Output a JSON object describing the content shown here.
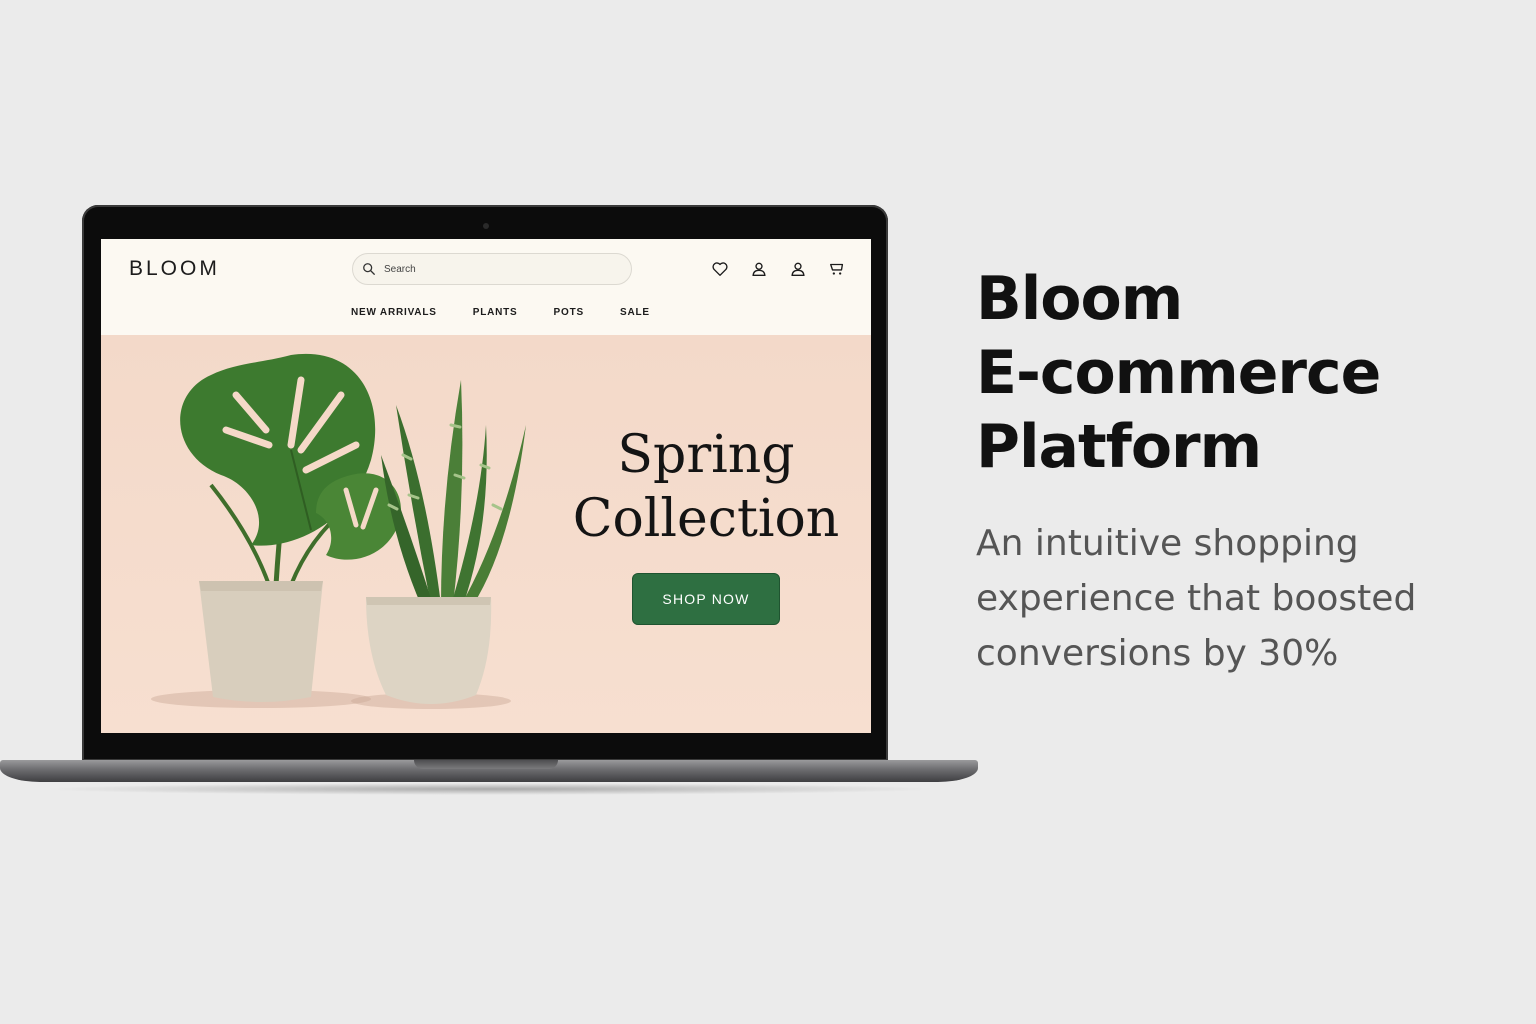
{
  "site": {
    "logo": "BLOOM",
    "search_placeholder": "Search",
    "header_icons": [
      "heart-icon",
      "user-icon",
      "account-icon",
      "cart-icon"
    ],
    "nav": [
      "NEW ARRIVALS",
      "PLANTS",
      "POTS",
      "SALE"
    ]
  },
  "hero": {
    "title_line1": "Spring",
    "title_line2": "Collection",
    "button_label": "SHOP NOW",
    "button_color": "#2e6f41",
    "background_color": "#f3d9c9"
  },
  "showcase": {
    "headline": [
      "Bloom",
      "E-commerce",
      "Platform"
    ],
    "subtext": "An intuitive shopping experience that boosted conversions by 30%"
  }
}
